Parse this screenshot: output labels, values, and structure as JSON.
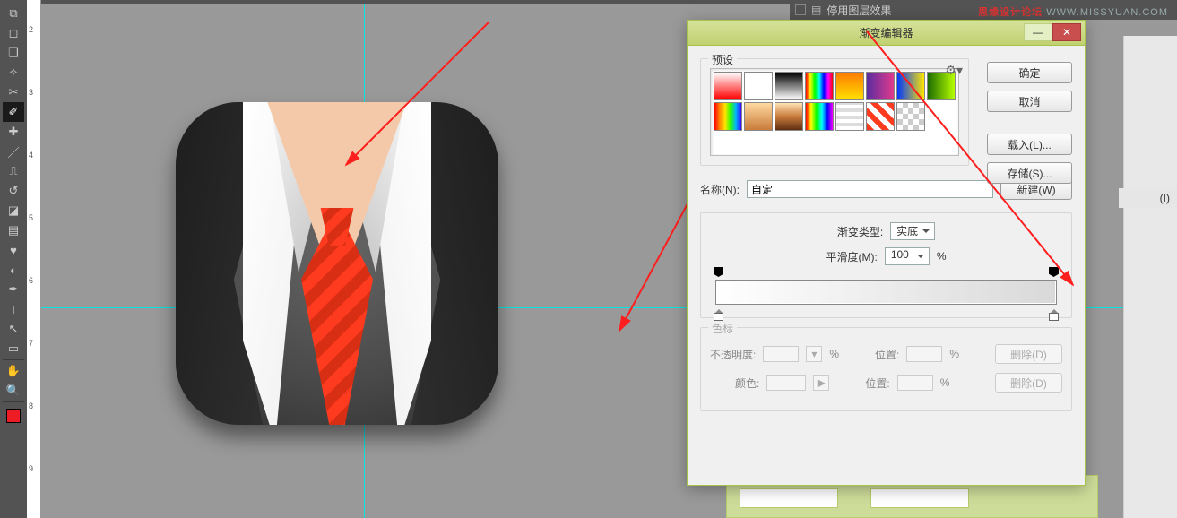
{
  "app": {
    "disable_layer_fx": "停用图层效果"
  },
  "watermark": {
    "brand_a": "思缘设计论坛",
    "brand_b": "WWW.MISSYUAN.COM"
  },
  "ruler": {
    "ticks": [
      "2",
      "3",
      "4",
      "5",
      "6",
      "7",
      "8",
      "9"
    ]
  },
  "tools": [
    {
      "id": "move",
      "glyph": "↔"
    },
    {
      "id": "marquee",
      "glyph": "▭"
    },
    {
      "id": "lasso",
      "glyph": "⌇"
    },
    {
      "id": "wand",
      "glyph": "✦"
    },
    {
      "id": "crop",
      "glyph": "✂"
    },
    {
      "id": "eyedropper",
      "glyph": "✎",
      "active": true
    },
    {
      "id": "healing",
      "glyph": "✚"
    },
    {
      "id": "brush",
      "glyph": "🖌"
    },
    {
      "id": "stamp",
      "glyph": "⎌"
    },
    {
      "id": "history",
      "glyph": "↺"
    },
    {
      "id": "eraser",
      "glyph": "◧"
    },
    {
      "id": "gradient",
      "glyph": "▦"
    },
    {
      "id": "blur",
      "glyph": "●"
    },
    {
      "id": "dodge",
      "glyph": "◐"
    },
    {
      "id": "pen",
      "glyph": "✒"
    },
    {
      "id": "type",
      "glyph": "T"
    },
    {
      "id": "path",
      "glyph": "↗"
    },
    {
      "id": "shape",
      "glyph": "▭"
    },
    {
      "id": "hand",
      "glyph": "✋"
    },
    {
      "id": "zoom",
      "glyph": "🔍"
    }
  ],
  "dialog": {
    "title": "渐变编辑器",
    "presets_label": "预设",
    "ok": "确定",
    "cancel": "取消",
    "load": "载入(L)...",
    "save": "存储(S)...",
    "name_label": "名称(N):",
    "name_value": "自定",
    "new_btn": "新建(W)",
    "grad_type_label": "渐变类型:",
    "grad_type_value": "实底",
    "smooth_label": "平滑度(M):",
    "smooth_value": "100",
    "percent": "%",
    "stops_label": "色标",
    "opacity_label": "不透明度:",
    "position_label": "位置:",
    "color_label": "颜色:",
    "delete": "删除(D)",
    "presets": [
      "linear-gradient(#fff,#ff0000)",
      "linear-gradient(45deg,#fff 25%,transparent 25%),linear-gradient(-45deg,#fff 25%,transparent 25%)",
      "linear-gradient(#000,#fff)",
      "linear-gradient(90deg,#ff0000,#ffff00,#00ff00,#00ffff,#0000ff,#ff00ff,#ff0000)",
      "linear-gradient(#ff7b00,#ffe000)",
      "linear-gradient(90deg,#5a2ca0,#e03a8c)",
      "linear-gradient(90deg,#0038ff,#ffe600)",
      "linear-gradient(90deg,#1d6b00,#b7ff00)",
      "linear-gradient(90deg,#ff0000,#ff8a00,#ffe600,#2cff00,#00b3ff,#3a00ff)",
      "linear-gradient(#ffd9a0,#c97b3a)",
      "linear-gradient(#ffe1b3,#c77b3a,#5e2f12)",
      "linear-gradient(90deg,#ff0000,#ffff00,#00ff00,#00ffff,#0000ff,#ff00ff)",
      "repeating-linear-gradient(0deg,#fff 0 4px,#ddd 4px 8px)",
      "repeating-linear-gradient(45deg,#ff3b1f 0 6px,#fff 6px 12px)",
      "repeating-conic-gradient(#ccc 0 25%,#fff 0 50%)"
    ]
  },
  "side_label": "(I)"
}
